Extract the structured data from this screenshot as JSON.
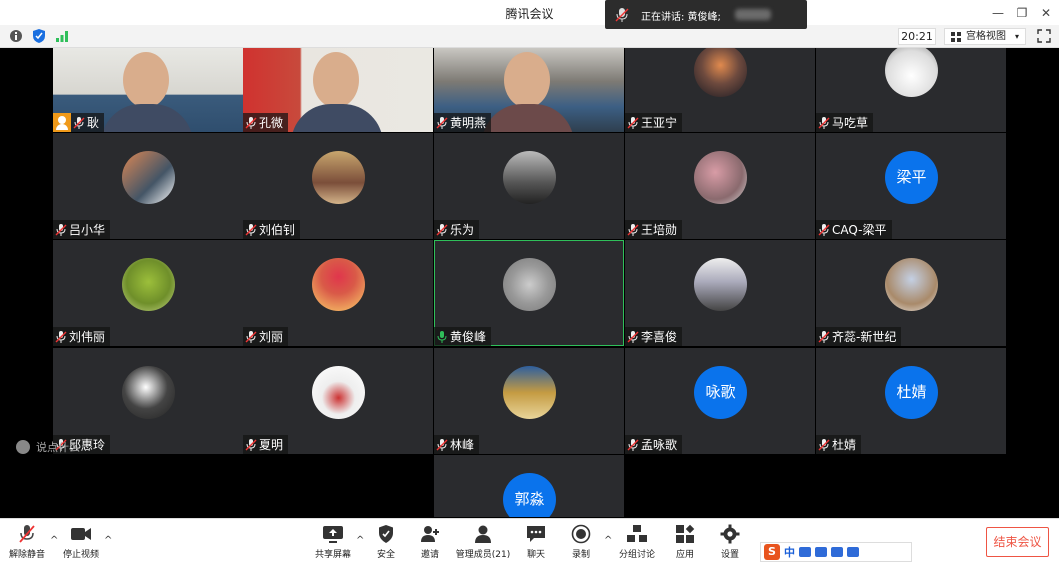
{
  "window": {
    "title": "腾讯会议",
    "min": "—",
    "restore": "❐",
    "close": "✕"
  },
  "toolbar": {
    "clock": "20:21",
    "view_label": "宫格视图",
    "view_dropdown": "▾"
  },
  "speaking": {
    "prefix": "正在讲话: 黄俊峰;"
  },
  "tiles": [
    {
      "name": "耿",
      "type": "video",
      "host": true
    },
    {
      "name": "孔微",
      "type": "video"
    },
    {
      "name": "黄明燕",
      "type": "video"
    },
    {
      "name": "王亚宁",
      "type": "avatar"
    },
    {
      "name": "马吃草",
      "type": "avatar"
    },
    {
      "name": "吕小华",
      "type": "avatar"
    },
    {
      "name": "刘伯钊",
      "type": "avatar"
    },
    {
      "name": "乐为",
      "type": "avatar"
    },
    {
      "name": "王培勋",
      "type": "avatar"
    },
    {
      "name": "CAQ-梁平",
      "type": "text",
      "initials": "梁平"
    },
    {
      "name": "刘伟丽",
      "type": "avatar"
    },
    {
      "name": "刘丽",
      "type": "avatar"
    },
    {
      "name": "黄俊峰",
      "type": "avatar",
      "speaking": true
    },
    {
      "name": "李喜俊",
      "type": "avatar"
    },
    {
      "name": "齐蕊-新世纪",
      "type": "avatar"
    },
    {
      "name": "邱惠玲",
      "type": "avatar"
    },
    {
      "name": "夏明",
      "type": "avatar"
    },
    {
      "name": "林峰",
      "type": "avatar"
    },
    {
      "name": "孟咏歌",
      "type": "text",
      "initials": "咏歌"
    },
    {
      "name": "杜婧",
      "type": "text",
      "initials": "杜婧"
    },
    {
      "name": "郭淼",
      "type": "text",
      "initials": "郭淼"
    }
  ],
  "chat_overlay": {
    "hint": "说点什么…",
    "chevron": "‹"
  },
  "controls": {
    "unmute": "解除静音",
    "stop_video": "停止视频",
    "share_screen": "共享屏幕",
    "security": "安全",
    "invite": "邀请",
    "manage_members": "管理成员(21)",
    "chat": "聊天",
    "record": "录制",
    "breakout": "分组讨论",
    "apps": "应用",
    "settings": "设置",
    "end_meeting": "结束会议",
    "caret": "^"
  },
  "ime": {
    "logo": "S",
    "lang": "中"
  },
  "colors": {
    "accent_blue": "#0a73ec",
    "speaking_green": "#2fbf5a",
    "end_red": "#e54"
  }
}
